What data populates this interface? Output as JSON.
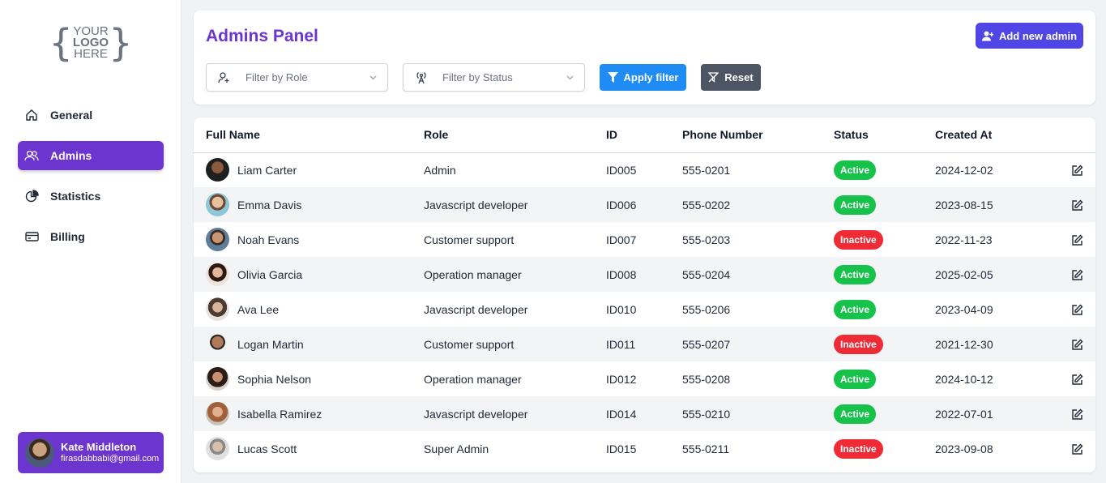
{
  "logo": {
    "line1": "YOUR",
    "line2": "LOGO",
    "line3": "HERE",
    "brace_left": "{",
    "brace_right": "}"
  },
  "sidebar": {
    "items": [
      {
        "label": "General",
        "icon": "home-icon"
      },
      {
        "label": "Admins",
        "icon": "users-icon",
        "active": true
      },
      {
        "label": "Statistics",
        "icon": "pie-chart-icon"
      },
      {
        "label": "Billing",
        "icon": "credit-card-icon"
      }
    ]
  },
  "user": {
    "name": "Kate Middleton",
    "email": "firasdabbabi@gmail.com"
  },
  "header": {
    "title": "Admins Panel",
    "add_label": "Add new admin",
    "role_placeholder": "Filter by Role",
    "status_placeholder": "Filter by Status",
    "apply_label": "Apply filter",
    "reset_label": "Reset"
  },
  "table": {
    "columns": [
      "Full Name",
      "Role",
      "ID",
      "Phone Number",
      "Status",
      "Created At"
    ],
    "rows": [
      {
        "name": "Liam Carter",
        "role": "Admin",
        "id": "ID005",
        "phone": "555-0201",
        "status": "Active",
        "created": "2024-12-02"
      },
      {
        "name": "Emma Davis",
        "role": "Javascript developer",
        "id": "ID006",
        "phone": "555-0202",
        "status": "Active",
        "created": "2023-08-15"
      },
      {
        "name": "Noah Evans",
        "role": "Customer support",
        "id": "ID007",
        "phone": "555-0203",
        "status": "Inactive",
        "created": "2022-11-23"
      },
      {
        "name": "Olivia Garcia",
        "role": "Operation manager",
        "id": "ID008",
        "phone": "555-0204",
        "status": "Active",
        "created": "2025-02-05"
      },
      {
        "name": "Ava Lee",
        "role": "Javascript developer",
        "id": "ID010",
        "phone": "555-0206",
        "status": "Active",
        "created": "2023-04-09"
      },
      {
        "name": "Logan Martin",
        "role": "Customer support",
        "id": "ID011",
        "phone": "555-0207",
        "status": "Inactive",
        "created": "2021-12-30"
      },
      {
        "name": "Sophia Nelson",
        "role": "Operation manager",
        "id": "ID012",
        "phone": "555-0208",
        "status": "Active",
        "created": "2024-10-12"
      },
      {
        "name": "Isabella Ramirez",
        "role": "Javascript developer",
        "id": "ID014",
        "phone": "555-0210",
        "status": "Active",
        "created": "2022-07-01"
      },
      {
        "name": "Lucas Scott",
        "role": "Super Admin",
        "id": "ID015",
        "phone": "555-0211",
        "status": "Inactive",
        "created": "2023-09-08"
      }
    ]
  },
  "colors": {
    "accent": "#6d35d0",
    "primary_button": "#4f46e5",
    "apply_button": "#1f8bf5",
    "reset_button": "#4b5563",
    "active": "#16c24a",
    "inactive": "#ef2b36"
  }
}
